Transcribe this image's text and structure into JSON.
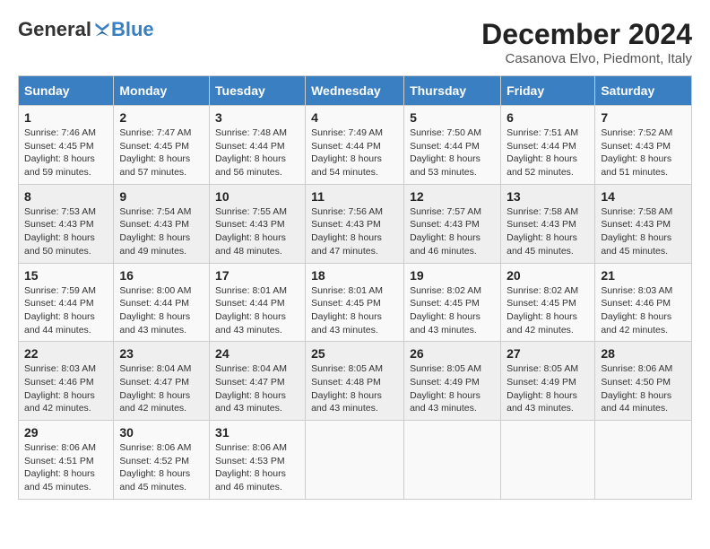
{
  "header": {
    "logo_general": "General",
    "logo_blue": "Blue",
    "title": "December 2024",
    "subtitle": "Casanova Elvo, Piedmont, Italy"
  },
  "days_of_week": [
    "Sunday",
    "Monday",
    "Tuesday",
    "Wednesday",
    "Thursday",
    "Friday",
    "Saturday"
  ],
  "weeks": [
    [
      {
        "day": "1",
        "sunrise": "Sunrise: 7:46 AM",
        "sunset": "Sunset: 4:45 PM",
        "daylight": "Daylight: 8 hours and 59 minutes."
      },
      {
        "day": "2",
        "sunrise": "Sunrise: 7:47 AM",
        "sunset": "Sunset: 4:45 PM",
        "daylight": "Daylight: 8 hours and 57 minutes."
      },
      {
        "day": "3",
        "sunrise": "Sunrise: 7:48 AM",
        "sunset": "Sunset: 4:44 PM",
        "daylight": "Daylight: 8 hours and 56 minutes."
      },
      {
        "day": "4",
        "sunrise": "Sunrise: 7:49 AM",
        "sunset": "Sunset: 4:44 PM",
        "daylight": "Daylight: 8 hours and 54 minutes."
      },
      {
        "day": "5",
        "sunrise": "Sunrise: 7:50 AM",
        "sunset": "Sunset: 4:44 PM",
        "daylight": "Daylight: 8 hours and 53 minutes."
      },
      {
        "day": "6",
        "sunrise": "Sunrise: 7:51 AM",
        "sunset": "Sunset: 4:44 PM",
        "daylight": "Daylight: 8 hours and 52 minutes."
      },
      {
        "day": "7",
        "sunrise": "Sunrise: 7:52 AM",
        "sunset": "Sunset: 4:43 PM",
        "daylight": "Daylight: 8 hours and 51 minutes."
      }
    ],
    [
      {
        "day": "8",
        "sunrise": "Sunrise: 7:53 AM",
        "sunset": "Sunset: 4:43 PM",
        "daylight": "Daylight: 8 hours and 50 minutes."
      },
      {
        "day": "9",
        "sunrise": "Sunrise: 7:54 AM",
        "sunset": "Sunset: 4:43 PM",
        "daylight": "Daylight: 8 hours and 49 minutes."
      },
      {
        "day": "10",
        "sunrise": "Sunrise: 7:55 AM",
        "sunset": "Sunset: 4:43 PM",
        "daylight": "Daylight: 8 hours and 48 minutes."
      },
      {
        "day": "11",
        "sunrise": "Sunrise: 7:56 AM",
        "sunset": "Sunset: 4:43 PM",
        "daylight": "Daylight: 8 hours and 47 minutes."
      },
      {
        "day": "12",
        "sunrise": "Sunrise: 7:57 AM",
        "sunset": "Sunset: 4:43 PM",
        "daylight": "Daylight: 8 hours and 46 minutes."
      },
      {
        "day": "13",
        "sunrise": "Sunrise: 7:58 AM",
        "sunset": "Sunset: 4:43 PM",
        "daylight": "Daylight: 8 hours and 45 minutes."
      },
      {
        "day": "14",
        "sunrise": "Sunrise: 7:58 AM",
        "sunset": "Sunset: 4:43 PM",
        "daylight": "Daylight: 8 hours and 45 minutes."
      }
    ],
    [
      {
        "day": "15",
        "sunrise": "Sunrise: 7:59 AM",
        "sunset": "Sunset: 4:44 PM",
        "daylight": "Daylight: 8 hours and 44 minutes."
      },
      {
        "day": "16",
        "sunrise": "Sunrise: 8:00 AM",
        "sunset": "Sunset: 4:44 PM",
        "daylight": "Daylight: 8 hours and 43 minutes."
      },
      {
        "day": "17",
        "sunrise": "Sunrise: 8:01 AM",
        "sunset": "Sunset: 4:44 PM",
        "daylight": "Daylight: 8 hours and 43 minutes."
      },
      {
        "day": "18",
        "sunrise": "Sunrise: 8:01 AM",
        "sunset": "Sunset: 4:45 PM",
        "daylight": "Daylight: 8 hours and 43 minutes."
      },
      {
        "day": "19",
        "sunrise": "Sunrise: 8:02 AM",
        "sunset": "Sunset: 4:45 PM",
        "daylight": "Daylight: 8 hours and 43 minutes."
      },
      {
        "day": "20",
        "sunrise": "Sunrise: 8:02 AM",
        "sunset": "Sunset: 4:45 PM",
        "daylight": "Daylight: 8 hours and 42 minutes."
      },
      {
        "day": "21",
        "sunrise": "Sunrise: 8:03 AM",
        "sunset": "Sunset: 4:46 PM",
        "daylight": "Daylight: 8 hours and 42 minutes."
      }
    ],
    [
      {
        "day": "22",
        "sunrise": "Sunrise: 8:03 AM",
        "sunset": "Sunset: 4:46 PM",
        "daylight": "Daylight: 8 hours and 42 minutes."
      },
      {
        "day": "23",
        "sunrise": "Sunrise: 8:04 AM",
        "sunset": "Sunset: 4:47 PM",
        "daylight": "Daylight: 8 hours and 42 minutes."
      },
      {
        "day": "24",
        "sunrise": "Sunrise: 8:04 AM",
        "sunset": "Sunset: 4:47 PM",
        "daylight": "Daylight: 8 hours and 43 minutes."
      },
      {
        "day": "25",
        "sunrise": "Sunrise: 8:05 AM",
        "sunset": "Sunset: 4:48 PM",
        "daylight": "Daylight: 8 hours and 43 minutes."
      },
      {
        "day": "26",
        "sunrise": "Sunrise: 8:05 AM",
        "sunset": "Sunset: 4:49 PM",
        "daylight": "Daylight: 8 hours and 43 minutes."
      },
      {
        "day": "27",
        "sunrise": "Sunrise: 8:05 AM",
        "sunset": "Sunset: 4:49 PM",
        "daylight": "Daylight: 8 hours and 43 minutes."
      },
      {
        "day": "28",
        "sunrise": "Sunrise: 8:06 AM",
        "sunset": "Sunset: 4:50 PM",
        "daylight": "Daylight: 8 hours and 44 minutes."
      }
    ],
    [
      {
        "day": "29",
        "sunrise": "Sunrise: 8:06 AM",
        "sunset": "Sunset: 4:51 PM",
        "daylight": "Daylight: 8 hours and 45 minutes."
      },
      {
        "day": "30",
        "sunrise": "Sunrise: 8:06 AM",
        "sunset": "Sunset: 4:52 PM",
        "daylight": "Daylight: 8 hours and 45 minutes."
      },
      {
        "day": "31",
        "sunrise": "Sunrise: 8:06 AM",
        "sunset": "Sunset: 4:53 PM",
        "daylight": "Daylight: 8 hours and 46 minutes."
      },
      null,
      null,
      null,
      null
    ]
  ]
}
